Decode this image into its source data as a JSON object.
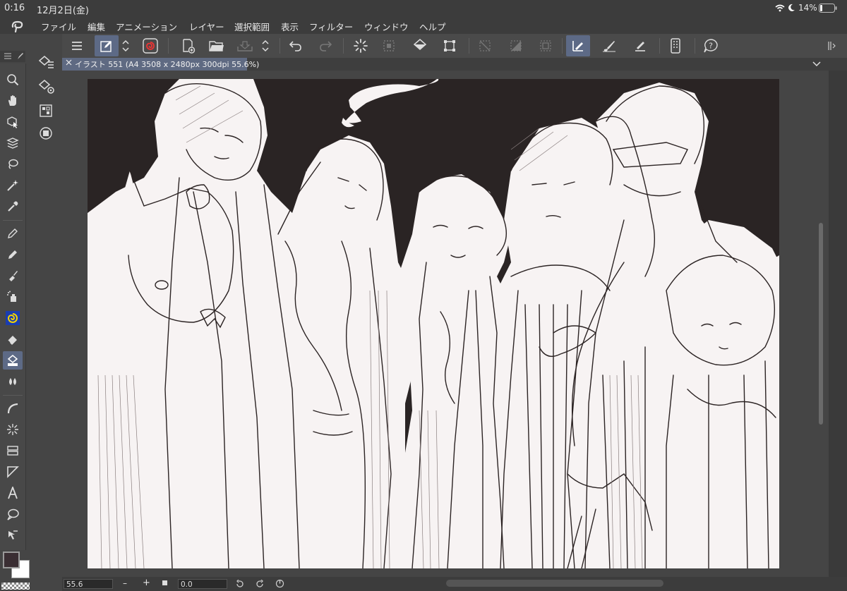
{
  "status_bar": {
    "time": "0:16",
    "date": "12月2日(金)",
    "battery": "14%",
    "icons": [
      "wifi-icon",
      "moon-icon",
      "battery-icon"
    ]
  },
  "menu": {
    "items": [
      "ファイル",
      "編集",
      "アニメーション",
      "レイヤー",
      "選択範囲",
      "表示",
      "フィルター",
      "ウィンドウ",
      "ヘルプ"
    ]
  },
  "toolbar": {
    "icons": [
      "menu-icon",
      "edit-pen-icon",
      "spinner-updown-icon",
      "spiral-app-icon",
      "new-file-icon",
      "open-folder-icon",
      "save-icon",
      "spinner-updown-icon",
      "undo-icon",
      "redo-icon",
      "loading-icon",
      "dotted-square-icon",
      "fill-bucket-icon",
      "transform-icon",
      "clear-selection-icon",
      "invert-icon",
      "crop-icon",
      "ruler-pen-icon",
      "brush-icon",
      "snap-icon",
      "phone-icon",
      "help-icon"
    ]
  },
  "document": {
    "tab_label": "イラスト 551 (A4 3508 x 2480px 300dpi 55.6%)"
  },
  "bottom": {
    "zoom_value": "55.6",
    "rotation_value": "0.0",
    "minus": "–",
    "plus": "+"
  },
  "colors": {
    "main_color": "#3a2e33",
    "sub_color": "#ffffff",
    "accent": "#5d6a86",
    "canvas_bg": "#2a2424"
  }
}
